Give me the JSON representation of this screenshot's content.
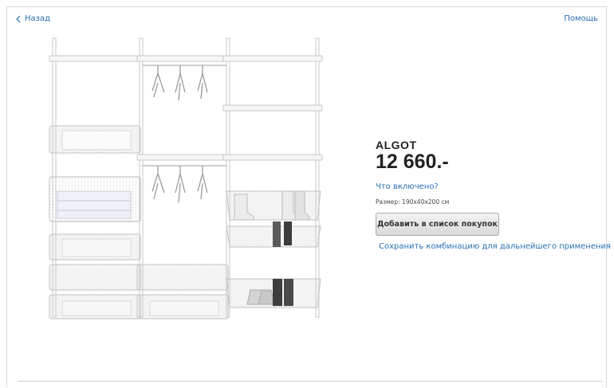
{
  "nav": {
    "back_label": "Назад",
    "help_label": "Помощь"
  },
  "product": {
    "name": "ALGOT",
    "price": "12 660.-",
    "whats_included_label": "Что включено?",
    "size_text": "Размер: 190x40x200 см",
    "add_button_label": "Добавить в список покупок",
    "save_label": "Сохранить комбинацию для дальнейшего применения",
    "image_description": "wardrobe-storage-system"
  },
  "colors": {
    "link": "#2a6fb3",
    "text": "#222222",
    "frame_border": "#d6d6d6"
  },
  "icons": {
    "back": "chevron-left-icon",
    "save": "add-to-list-icon"
  }
}
